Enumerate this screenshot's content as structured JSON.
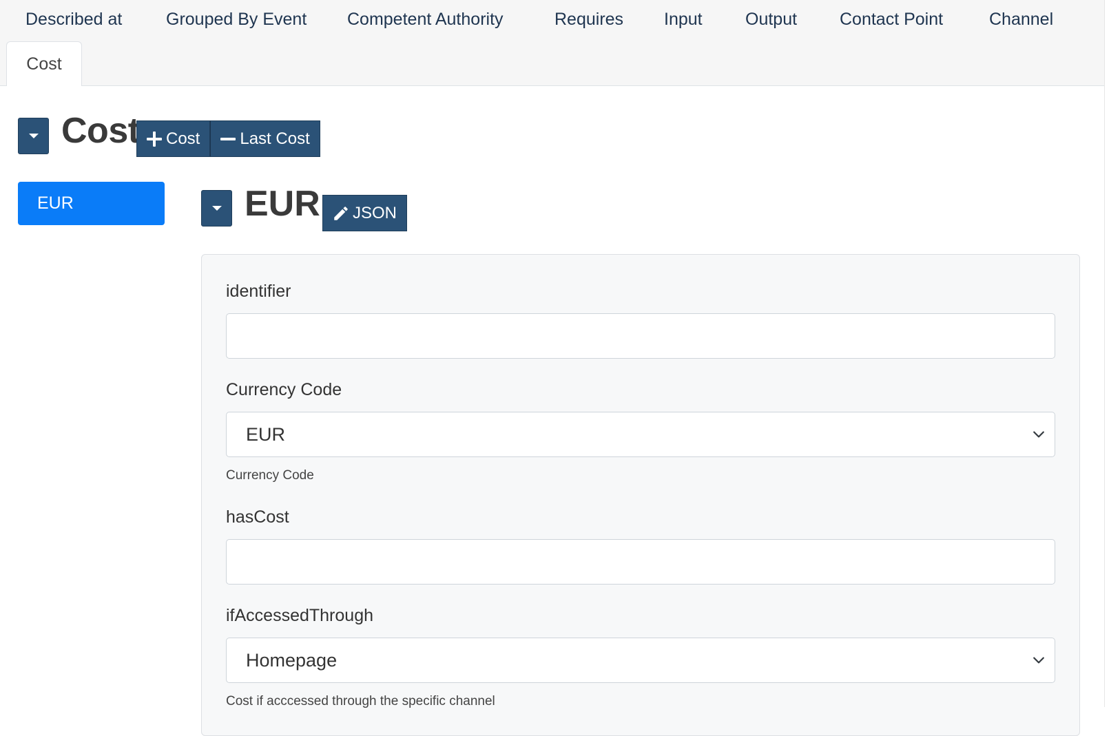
{
  "tabs": {
    "items": [
      "Described at",
      "Grouped By Event",
      "Competent Authority",
      "Requires",
      "Input",
      "Output",
      "Contact Point",
      "Channel"
    ],
    "active": "Cost"
  },
  "section": {
    "title": "Cost",
    "add_button": "Cost",
    "remove_button": "Last Cost"
  },
  "list": {
    "active_item": "EUR"
  },
  "item": {
    "title": "EUR",
    "json_button": "JSON"
  },
  "form": {
    "identifier": {
      "label": "identifier",
      "value": ""
    },
    "currency_code": {
      "label": "Currency Code",
      "value": "EUR",
      "help": "Currency Code"
    },
    "has_cost": {
      "label": "hasCost",
      "value": ""
    },
    "if_accessed_through": {
      "label": "ifAccessedThrough",
      "value": "Homepage",
      "help": "Cost if acccessed through the specific channel"
    }
  },
  "icons": {
    "collapse": "caret-down-icon",
    "add": "plus-icon",
    "remove": "minus-icon",
    "edit": "pencil-icon",
    "select": "chevron-down-icon"
  },
  "colors": {
    "primary_dark": "#2b5277",
    "active_blue": "#0a7cf8",
    "tab_text": "#1f3550"
  }
}
